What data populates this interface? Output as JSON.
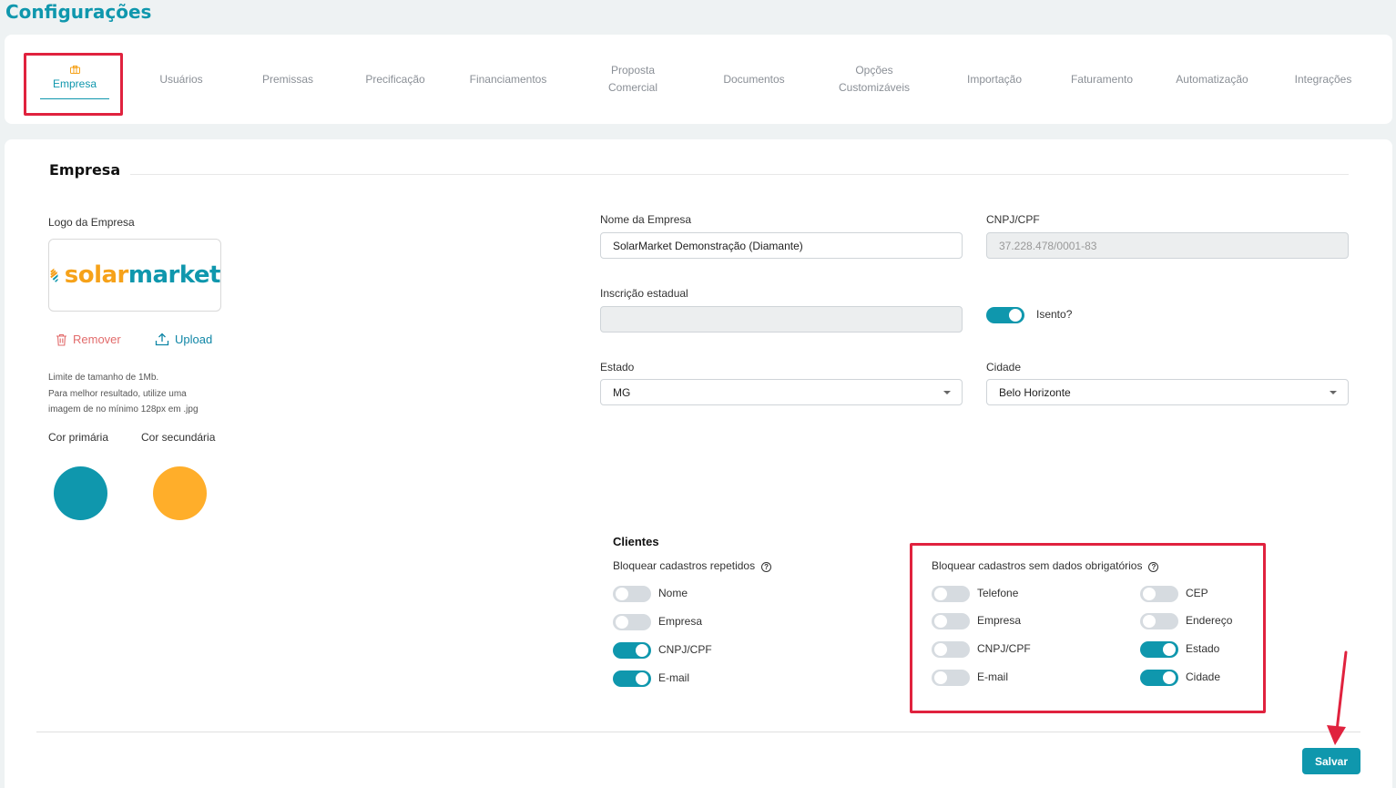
{
  "page": {
    "title": "Configurações"
  },
  "tabs": [
    {
      "label": "Empresa",
      "active": true
    },
    {
      "label": "Usuários"
    },
    {
      "label": "Premissas"
    },
    {
      "label": "Precificação"
    },
    {
      "label": "Financiamentos"
    },
    {
      "label": "Proposta\nComercial"
    },
    {
      "label": "Documentos"
    },
    {
      "label": "Opções\nCustomizáveis"
    },
    {
      "label": "Importação"
    },
    {
      "label": "Faturamento"
    },
    {
      "label": "Automatização"
    },
    {
      "label": "Integrações"
    }
  ],
  "section": {
    "title": "Empresa"
  },
  "logo": {
    "label": "Logo da Empresa",
    "brand_part1": "solar",
    "brand_part2": "market",
    "remove_label": "Remover",
    "upload_label": "Upload",
    "hint_lines": [
      "Limite de tamanho de 1Mb.",
      "Para melhor resultado, utilize uma",
      "imagem de no mínimo 128px em .jpg"
    ]
  },
  "colors": {
    "primary_label": "Cor primária",
    "secondary_label": "Cor secundária",
    "primary": "#0f97ad",
    "secondary": "#ffae2a"
  },
  "form": {
    "company_name_label": "Nome da Empresa",
    "company_name_value": "SolarMarket Demonstração (Diamante)",
    "cnpj_label": "CNPJ/CPF",
    "cnpj_value": "37.228.478/0001-83",
    "state_reg_label": "Inscrição estadual",
    "state_reg_value": "",
    "exempt_label": "Isento?",
    "exempt_on": true,
    "state_label": "Estado",
    "state_value": "MG",
    "city_label": "Cidade",
    "city_value": "Belo Horizonte"
  },
  "clients": {
    "title": "Clientes",
    "block_repeated_label": "Bloquear cadastros repetidos",
    "block_repeated": [
      {
        "label": "Nome",
        "on": false
      },
      {
        "label": "Empresa",
        "on": false
      },
      {
        "label": "CNPJ/CPF",
        "on": true
      },
      {
        "label": "E-mail",
        "on": true
      }
    ],
    "block_missing_label": "Bloquear cadastros sem dados obrigatórios",
    "block_missing_left": [
      {
        "label": "Telefone",
        "on": false
      },
      {
        "label": "Empresa",
        "on": false
      },
      {
        "label": "CNPJ/CPF",
        "on": false
      },
      {
        "label": "E-mail",
        "on": false
      }
    ],
    "block_missing_right": [
      {
        "label": "CEP",
        "on": false
      },
      {
        "label": "Endereço",
        "on": false
      },
      {
        "label": "Estado",
        "on": true
      },
      {
        "label": "Cidade",
        "on": true
      }
    ]
  },
  "actions": {
    "save_label": "Salvar"
  },
  "icons": {
    "briefcase": "briefcase-icon",
    "trash": "trash-icon",
    "upload": "upload-icon",
    "help": "help-circle-icon",
    "caret": "caret-down-icon"
  }
}
